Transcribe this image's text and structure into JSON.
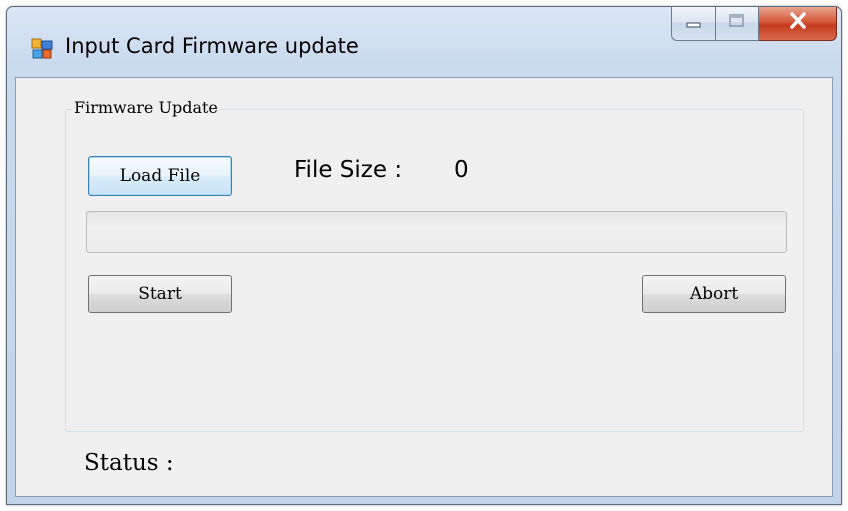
{
  "window": {
    "title": "Input Card Firmware update",
    "icon": "app-window-icon",
    "controls": {
      "minimize": "minimize-icon",
      "maximize": "maximize-icon",
      "close": "close-icon"
    }
  },
  "group": {
    "legend": "Firmware Update"
  },
  "buttons": {
    "load_file": "Load File",
    "start": "Start",
    "abort": "Abort"
  },
  "file_size": {
    "label": "File Size :",
    "value": "0"
  },
  "progress": {
    "value": 0
  },
  "status": {
    "label": "Status :"
  },
  "colors": {
    "accent_focus": "#3c7fb1",
    "close_button": "#c43b1e",
    "client_bg": "#f0f0f0"
  }
}
